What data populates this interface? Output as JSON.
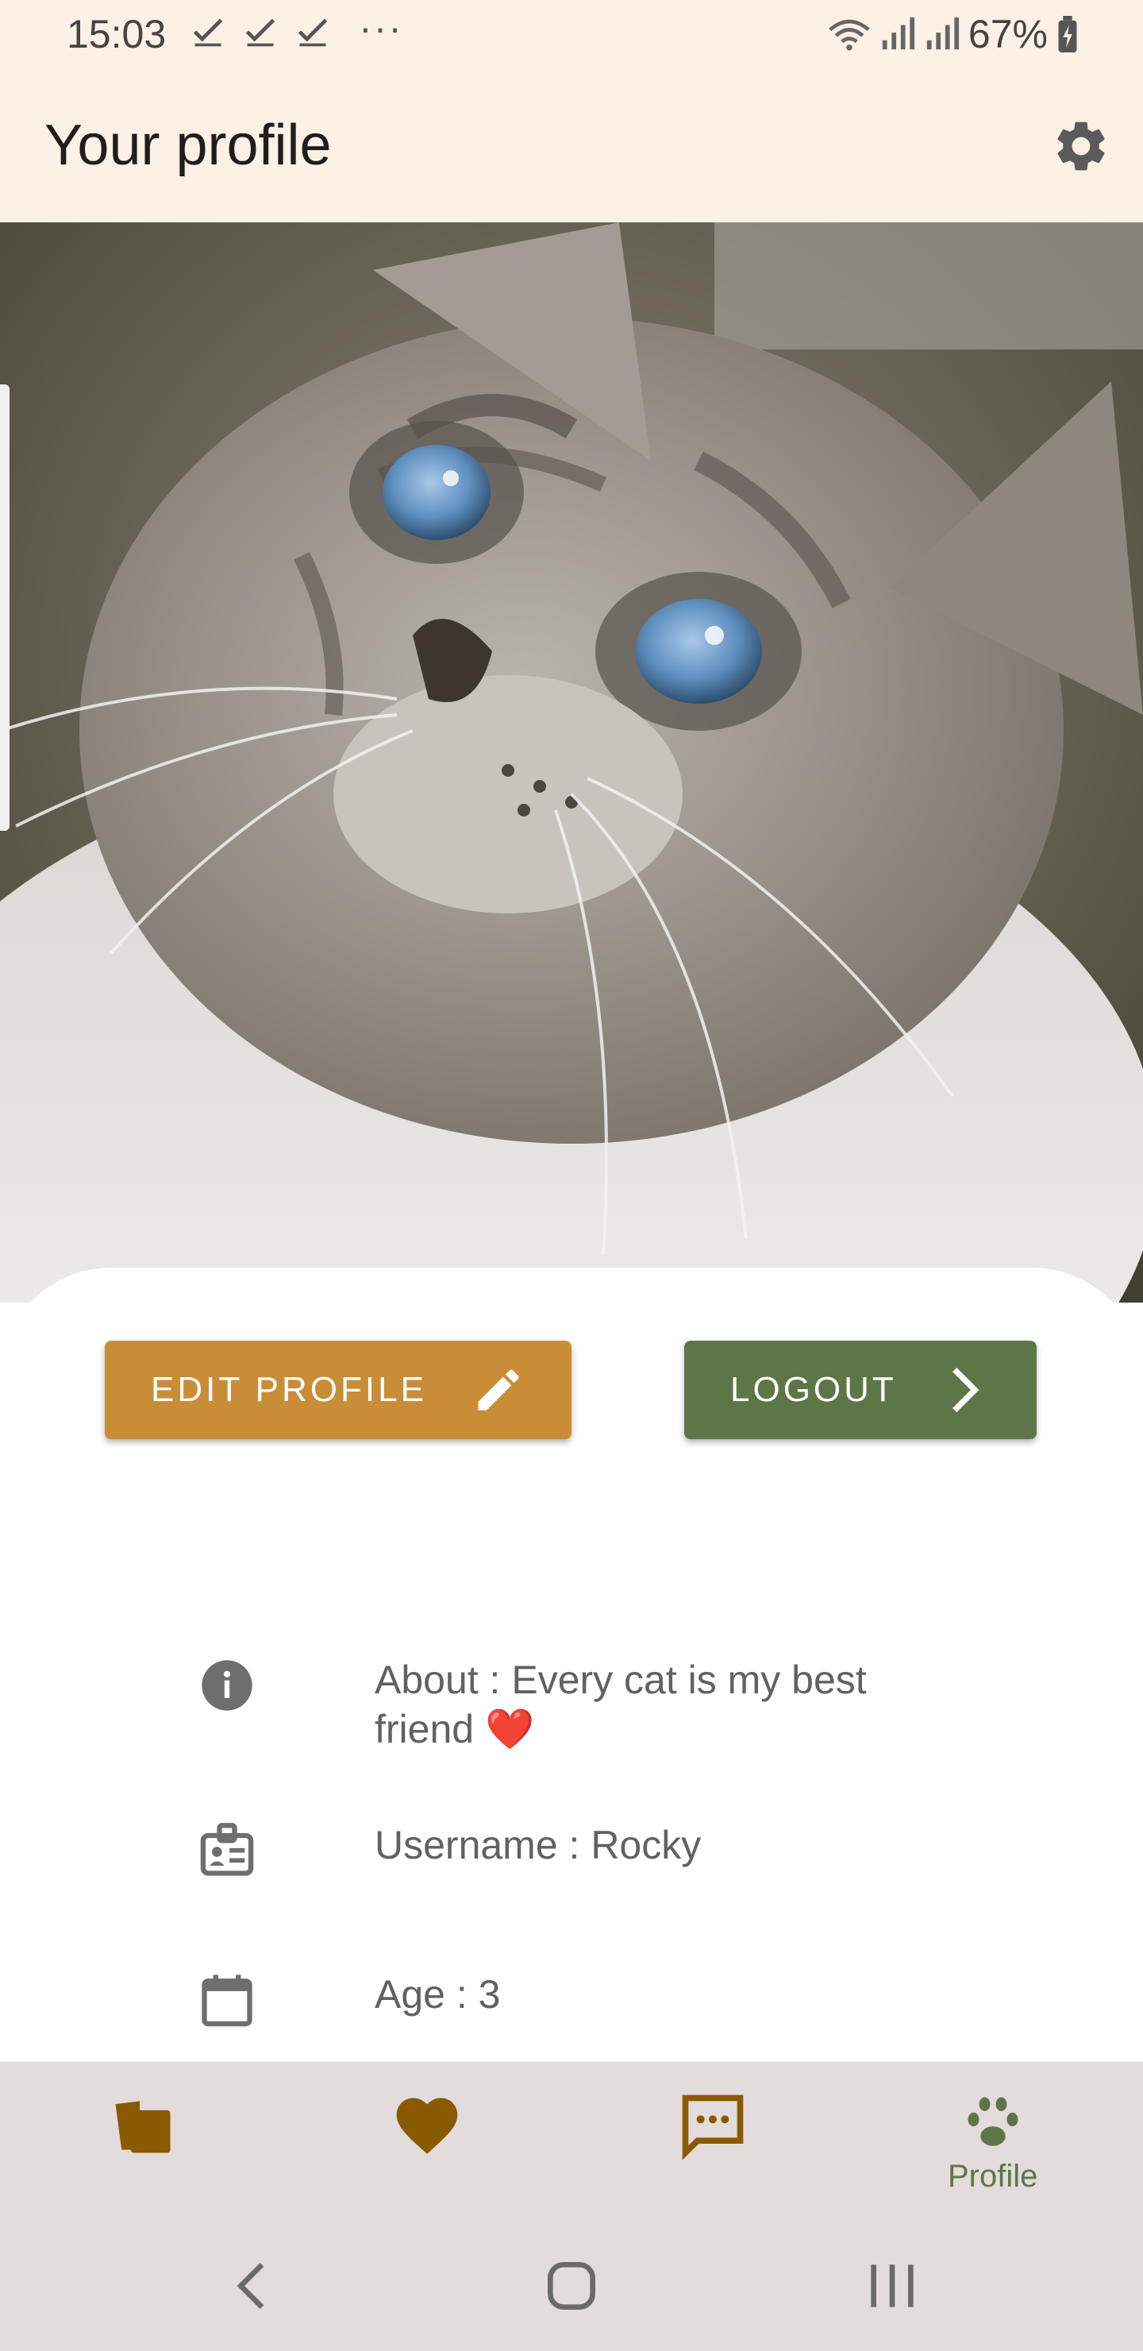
{
  "status_bar": {
    "time": "15:03",
    "battery": "67%",
    "more": "···"
  },
  "app_bar": {
    "title": "Your profile",
    "settings_icon": "gear-icon"
  },
  "actions": {
    "edit_label": "EDIT PROFILE",
    "edit_icon": "pencil-icon",
    "logout_label": "LOGOUT",
    "logout_icon": "chevron-right-icon"
  },
  "profile": {
    "about": "About : Every cat is my best friend ❤️",
    "username": "Username : Rocky",
    "age": "Age : 3"
  },
  "bottom_nav": {
    "items": [
      {
        "icon": "cards-icon",
        "label": ""
      },
      {
        "icon": "heart-icon",
        "label": ""
      },
      {
        "icon": "chat-icon",
        "label": ""
      },
      {
        "icon": "paw-icon",
        "label": "Profile"
      }
    ]
  },
  "colors": {
    "header_bg": "#fdf1e6",
    "edit_button": "#c98d38",
    "logout_button": "#5d7647",
    "nav_bg": "#e3dcdc",
    "nav_icon": "#8a5a00"
  }
}
